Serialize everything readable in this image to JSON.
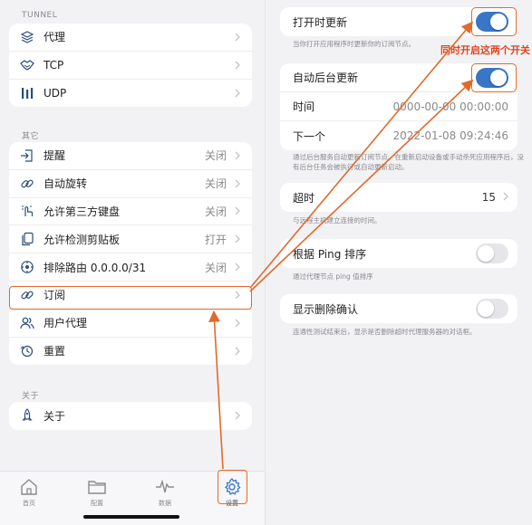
{
  "left": {
    "tunnel_title": "TUNNEL",
    "tunnel_items": [
      {
        "label": "代理",
        "icon": "layers-icon"
      },
      {
        "label": "TCP",
        "icon": "handshake-icon"
      },
      {
        "label": "UDP",
        "icon": "udp-bars-icon"
      }
    ],
    "other_title": "其它",
    "other_items": [
      {
        "label": "提醒",
        "value": "关闭",
        "icon": "enter-icon"
      },
      {
        "label": "自动旋转",
        "value": "关闭",
        "icon": "link-icon"
      },
      {
        "label": "允许第三方键盘",
        "value": "关闭",
        "icon": "keyboard-touch-icon"
      },
      {
        "label": "允许检测剪贴板",
        "value": "打开",
        "icon": "clipboard-icon"
      },
      {
        "label": "排除路由 0.0.0.0/31",
        "value": "关闭",
        "icon": "globe-icon"
      },
      {
        "label": "订阅",
        "value": "",
        "icon": "link-icon"
      },
      {
        "label": "用户代理",
        "value": "",
        "icon": "users-icon"
      },
      {
        "label": "重置",
        "value": "",
        "icon": "reset-icon"
      }
    ],
    "about_title": "关于",
    "about_items": [
      {
        "label": "关于",
        "icon": "rocket-icon"
      }
    ],
    "tabs": [
      {
        "label": "首页",
        "icon": "home-icon"
      },
      {
        "label": "配置",
        "icon": "folder-icon"
      },
      {
        "label": "数据",
        "icon": "activity-icon"
      },
      {
        "label": "设置",
        "icon": "gear-icon"
      }
    ]
  },
  "right": {
    "open_update": {
      "label": "打开时更新",
      "on": true,
      "desc": "当你打开应用程序时更新你的订阅节点。"
    },
    "bg_update": {
      "label": "自动后台更新",
      "on": true
    },
    "time": {
      "label": "时间",
      "value": "0000-00-00 00:00:00"
    },
    "next": {
      "label": "下一个",
      "value": "2022-01-08 09:24:46"
    },
    "bg_desc": "通过后台服务自动更新订阅节点。在重新启动设备或手动杀死应用程序后，没有后台任务会被执行或自动更新启动。",
    "timeout": {
      "label": "超时",
      "value": "15",
      "desc": "与远程主机建立连接的时间。"
    },
    "ping_sort": {
      "label": "根据 Ping 排序",
      "on": false,
      "desc": "通过代理节点 ping 值排序"
    },
    "delete_confirm": {
      "label": "显示删除确认",
      "on": false,
      "desc": "连通性测试结束后，显示是否删除超时代理服务器的对话框。"
    }
  },
  "annotation": "同时开启这两个开关",
  "colors": {
    "accent": "#3876c6",
    "highlight": "#e06a2c",
    "annotation": "#e0451d"
  }
}
